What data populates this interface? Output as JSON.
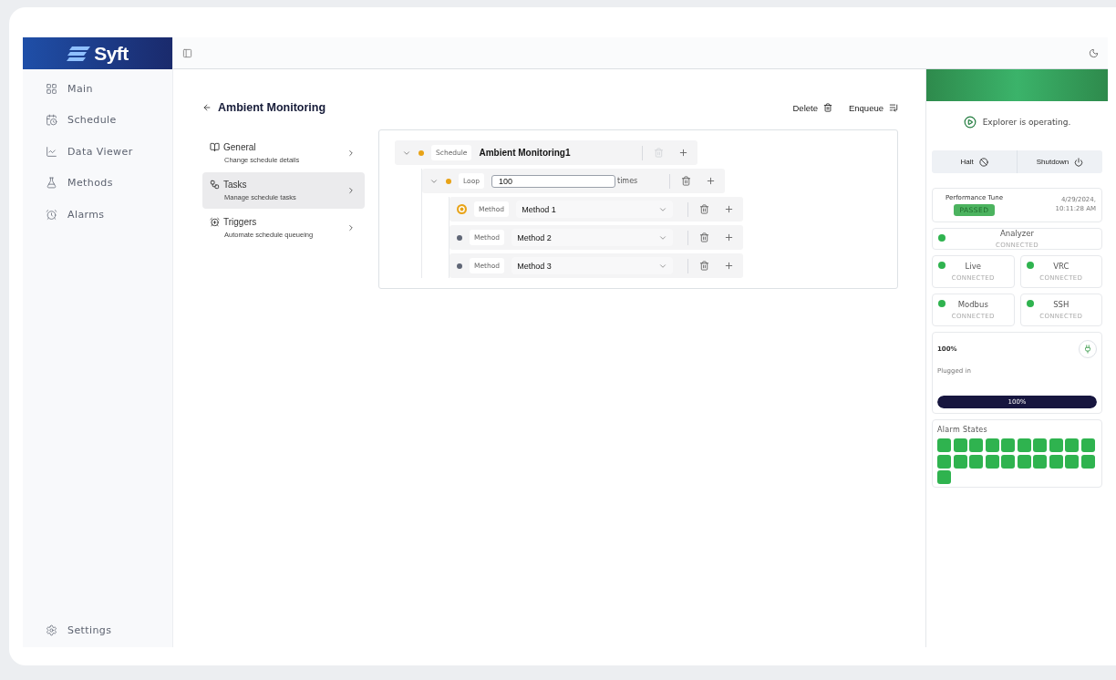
{
  "logo": {
    "text": "Syft"
  },
  "sidebar": {
    "items": [
      {
        "label": "Main",
        "selected": false
      },
      {
        "label": "Schedule",
        "selected": false
      },
      {
        "label": "Data Viewer",
        "selected": false
      },
      {
        "label": "Methods",
        "selected": false
      },
      {
        "label": "Alarms",
        "selected": false
      }
    ],
    "footer": {
      "label": "Settings"
    }
  },
  "page": {
    "title": "Ambient Monitoring",
    "actions": [
      {
        "label": "Delete"
      },
      {
        "label": "Enqueue"
      }
    ]
  },
  "sections": [
    {
      "title": "General",
      "subtitle": "Change schedule details",
      "selected": false
    },
    {
      "title": "Tasks",
      "subtitle": "Manage schedule tasks",
      "selected": true
    },
    {
      "title": "Triggers",
      "subtitle": "Automate schedule queueing",
      "selected": false
    }
  ],
  "tree": {
    "kind": "schedule",
    "tag": "Schedule",
    "value": "Ambient Monitoring1",
    "expanded": true,
    "active": false,
    "color": "#e8a317",
    "delete_disabled": true,
    "children": [
      {
        "kind": "loop",
        "tag": "Loop",
        "value": "100",
        "suffix": "times",
        "expanded": true,
        "active": false,
        "color": "#e8a317",
        "delete_disabled": false,
        "children": [
          {
            "kind": "method",
            "tag": "Method",
            "value": "Method 1",
            "active": true,
            "color": "#e8a317",
            "delete_disabled": false
          },
          {
            "kind": "method",
            "tag": "Method",
            "value": "Method 2",
            "active": false,
            "color": "#5f6675",
            "delete_disabled": false
          },
          {
            "kind": "method",
            "tag": "Method",
            "value": "Method 3",
            "active": false,
            "color": "#5f6675",
            "delete_disabled": false
          }
        ]
      }
    ]
  },
  "status_panel": {
    "status": "Explorer is operating.",
    "controls": [
      {
        "label": "Halt"
      },
      {
        "label": "Shutdown"
      }
    ],
    "performance": {
      "title": "Performance Tune",
      "badge": "PASSED",
      "timestamp": "4/29/2024, 10:11:28 AM"
    },
    "connections": [
      {
        "name": "Analyzer",
        "status": "CONNECTED",
        "color": "#2fb34f"
      },
      {
        "name": "Live",
        "status": "CONNECTED",
        "color": "#2fb34f"
      },
      {
        "name": "VRC",
        "status": "CONNECTED",
        "color": "#2fb34f"
      },
      {
        "name": "Modbus",
        "status": "CONNECTED",
        "color": "#2fb34f"
      },
      {
        "name": "SSH",
        "status": "CONNECTED",
        "color": "#2fb34f"
      }
    ],
    "battery": {
      "reading": "100%",
      "state": "Plugged in",
      "level": 1,
      "bar_label": "100%"
    },
    "alarm_states": {
      "title": "Alarm States",
      "alarms": [
        {
          "color": "#2fb34f"
        },
        {
          "color": "#2fb34f"
        },
        {
          "color": "#2fb34f"
        },
        {
          "color": "#2fb34f"
        },
        {
          "color": "#2fb34f"
        },
        {
          "color": "#2fb34f"
        },
        {
          "color": "#2fb34f"
        },
        {
          "color": "#2fb34f"
        },
        {
          "color": "#2fb34f"
        },
        {
          "color": "#2fb34f"
        },
        {
          "color": "#2fb34f"
        },
        {
          "color": "#2fb34f"
        },
        {
          "color": "#2fb34f"
        },
        {
          "color": "#2fb34f"
        },
        {
          "color": "#2fb34f"
        },
        {
          "color": "#2fb34f"
        },
        {
          "color": "#2fb34f"
        },
        {
          "color": "#2fb34f"
        },
        {
          "color": "#2fb34f"
        },
        {
          "color": "#2fb34f"
        },
        {
          "color": "#2fb34f"
        }
      ]
    }
  }
}
